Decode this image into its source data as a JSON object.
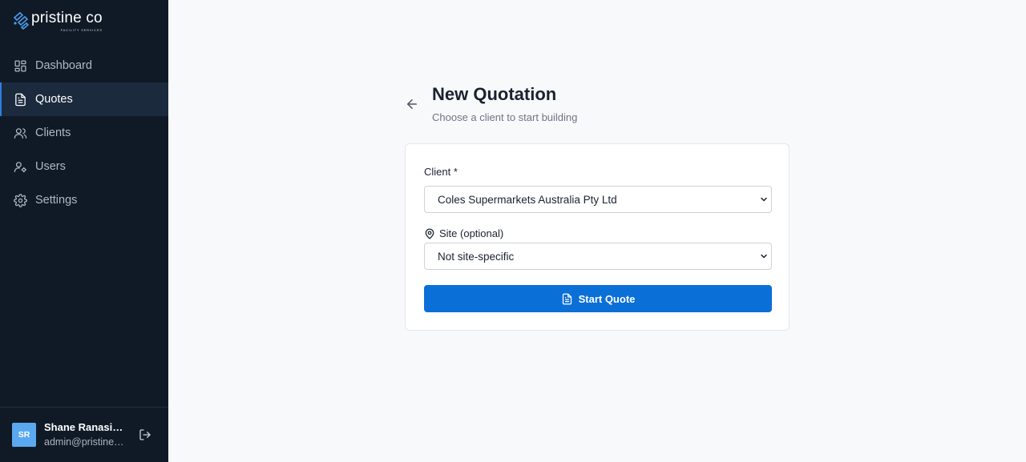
{
  "brand": {
    "name": "pristine co",
    "tagline": "FACILITY SERVICES",
    "accent": "#2f7fe0"
  },
  "nav": {
    "items": [
      {
        "label": "Dashboard",
        "icon": "dashboard-icon",
        "active": false
      },
      {
        "label": "Quotes",
        "icon": "document-icon",
        "active": true
      },
      {
        "label": "Clients",
        "icon": "users-icon",
        "active": false
      },
      {
        "label": "Users",
        "icon": "user-gear-icon",
        "active": false
      },
      {
        "label": "Settings",
        "icon": "gear-icon",
        "active": false
      }
    ]
  },
  "user": {
    "initials": "SR",
    "name": "Shane Ranasinghe",
    "email": "admin@pristineco.com.au"
  },
  "page": {
    "title": "New Quotation",
    "subtitle": "Choose a client to start building"
  },
  "form": {
    "client_label": "Client *",
    "client_value": "Coles Supermarkets Australia Pty Ltd",
    "site_label": "Site (optional)",
    "site_value": "Not site-specific",
    "submit_label": "Start Quote",
    "button_color": "#0b6fd8"
  }
}
